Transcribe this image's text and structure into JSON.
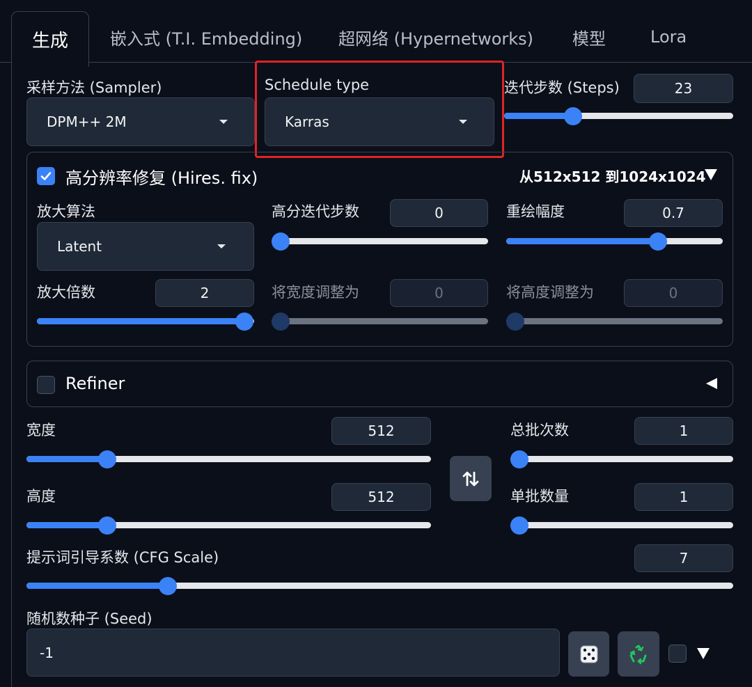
{
  "tabs": [
    {
      "label": "生成",
      "active": true
    },
    {
      "label": "嵌入式 (T.I. Embedding)"
    },
    {
      "label": "超网络 (Hypernetworks)"
    },
    {
      "label": "模型"
    },
    {
      "label": "Lora"
    }
  ],
  "sampler": {
    "label": "采样方法 (Sampler)",
    "value": "DPM++ 2M"
  },
  "schedule": {
    "label": "Schedule type",
    "value": "Karras",
    "highlighted": true,
    "highlight_color": "#e02424"
  },
  "steps": {
    "label": "迭代步数 (Steps)",
    "value": "23",
    "fraction": 0.3
  },
  "hires": {
    "label": "高分辨率修复 (Hires. fix)",
    "checked": true,
    "summary": "从512x512 到1024x1024",
    "upscaler": {
      "label": "放大算法",
      "value": "Latent"
    },
    "hires_steps": {
      "label": "高分迭代步数",
      "value": "0",
      "fraction": 0.0
    },
    "denoise": {
      "label": "重绘幅度",
      "value": "0.7",
      "fraction": 0.7
    },
    "scale": {
      "label": "放大倍数",
      "value": "2",
      "fraction": 1.0
    },
    "resize_w": {
      "label": "将宽度调整为",
      "value": "0",
      "fraction": 0.0,
      "disabled": true
    },
    "resize_h": {
      "label": "将高度调整为",
      "value": "0",
      "fraction": 0.0,
      "disabled": true
    }
  },
  "refiner": {
    "label": "Refiner",
    "checked": false
  },
  "width": {
    "label": "宽度",
    "value": "512",
    "fraction": 0.2
  },
  "height": {
    "label": "高度",
    "value": "512",
    "fraction": 0.2
  },
  "batch_count": {
    "label": "总批次数",
    "value": "1",
    "fraction": 0.0
  },
  "batch_size": {
    "label": "单批数量",
    "value": "1",
    "fraction": 0.0
  },
  "cfg": {
    "label": "提示词引导系数 (CFG Scale)",
    "value": "7",
    "fraction": 0.2
  },
  "seed": {
    "label": "随机数种子 (Seed)",
    "value": "-1"
  },
  "icons": {
    "swap": "swap-vertical-arrows-icon",
    "dice": "dice-icon",
    "recycle": "recycle-icon",
    "caret": "chevron-down-icon"
  },
  "colors": {
    "accent": "#3b82f6",
    "background": "#0b0f19",
    "panel": "#1f2937"
  }
}
